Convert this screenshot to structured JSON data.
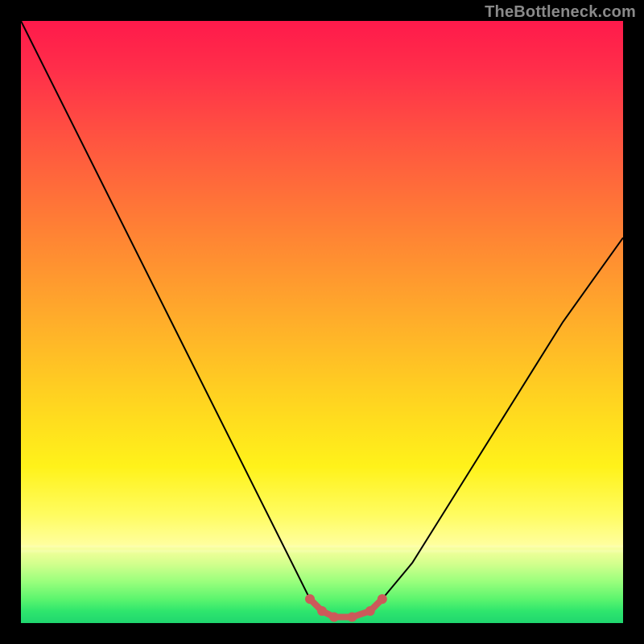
{
  "watermark": "TheBottleneck.com",
  "chart_data": {
    "type": "line",
    "title": "",
    "xlabel": "",
    "ylabel": "",
    "xlim": [
      0,
      100
    ],
    "ylim": [
      0,
      100
    ],
    "grid": false,
    "series": [
      {
        "name": "bottleneck-curve",
        "x": [
          0,
          5,
          10,
          15,
          20,
          25,
          30,
          35,
          40,
          45,
          48,
          50,
          52,
          55,
          58,
          60,
          65,
          70,
          75,
          80,
          85,
          90,
          95,
          100
        ],
        "values": [
          100,
          90,
          80,
          70,
          60,
          50,
          40,
          30,
          20,
          10,
          4,
          2,
          1,
          1,
          2,
          4,
          10,
          18,
          26,
          34,
          42,
          50,
          57,
          64
        ],
        "color": "#000000"
      },
      {
        "name": "optimal-band",
        "x": [
          48,
          50,
          52,
          55,
          58,
          60
        ],
        "values": [
          4,
          2,
          1,
          1,
          2,
          4
        ],
        "color": "#cc5a5a"
      }
    ],
    "annotations": [
      {
        "text": "TheBottleneck.com",
        "position": "top-right"
      }
    ]
  },
  "colors": {
    "background": "#000000",
    "gradient_top": "#ff1a4b",
    "gradient_mid": "#ffd420",
    "gradient_bottom": "#1fd66f",
    "curve": "#000000",
    "marker": "#cc5a5a",
    "watermark": "#8a8a8a"
  }
}
